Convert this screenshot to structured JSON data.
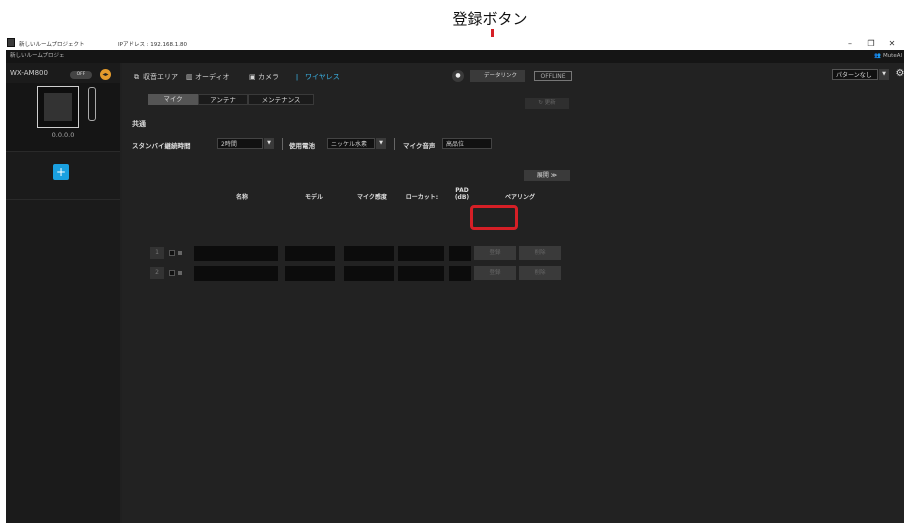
{
  "callout": {
    "label": "登録ボタン"
  },
  "window": {
    "title": "新しいルームプロジェクト",
    "ip_address": "IPアドレス : 192.168.1.80",
    "controls": {
      "minimize": "–",
      "restore": "❐",
      "close": "✕"
    }
  },
  "menubar": {
    "project_tab": "新しいルームプロジェ",
    "brand": "MuteAl"
  },
  "device": {
    "name": "WX-AM800",
    "power": "OFF",
    "ip": "0.0.0.0",
    "add_label": "+"
  },
  "tabs": [
    {
      "label": "収音エリア",
      "icon": "area-icon"
    },
    {
      "label": "オーディオ",
      "icon": "audio-icon"
    },
    {
      "label": "カメラ",
      "icon": "camera-icon"
    },
    {
      "label": "ワイヤレス",
      "icon": "wireless-icon",
      "active": true
    }
  ],
  "toolbar": {
    "datalink_label": "データリンク",
    "offline_label": "OFFLINE",
    "pattern_value": "パターンなし",
    "refresh_label": "更新"
  },
  "subtabs": [
    {
      "label": "マイク",
      "active": true
    },
    {
      "label": "アンテナ"
    },
    {
      "label": "メンテナンス"
    }
  ],
  "common": {
    "heading": "共通",
    "standby_label": "スタンバイ継続時間",
    "standby_value": "2時間",
    "battery_label": "使用電池",
    "battery_value": "ニッケル水素",
    "mic_audio_label": "マイク音声",
    "mic_audio_value": "高品位"
  },
  "expand_label": "展開 ≫",
  "columns": {
    "name": "名称",
    "model": "モデル",
    "sensitivity": "マイク感度",
    "lowcut": "ローカット:",
    "pad": "PAD\n(dB)",
    "pairing": "ペアリング"
  },
  "rows": [
    {
      "num": "1",
      "register": "登録",
      "delete": "削除"
    },
    {
      "num": "2",
      "register": "登録",
      "delete": "削除"
    }
  ],
  "colors": {
    "accent": "#1aa0e0",
    "highlight": "#d61f26",
    "orange": "#e39a2c"
  }
}
